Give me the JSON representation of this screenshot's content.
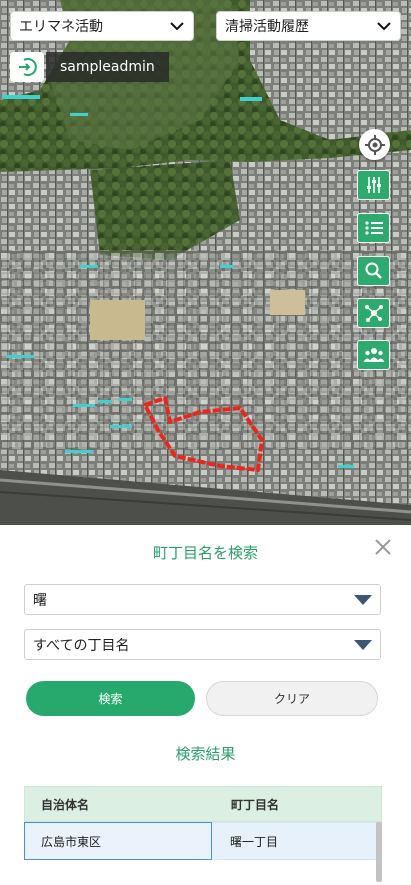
{
  "top": {
    "area_select": "エリマネ活動",
    "history_select": "清掃活動履歴"
  },
  "user": {
    "name": "sampleadmin"
  },
  "map_tools": [
    "locate-icon",
    "layer-adjust-icon",
    "list-icon",
    "search-icon",
    "network-icon",
    "group-icon"
  ],
  "panel": {
    "title": "町丁目名を検索",
    "area_value": "曙",
    "town_value": "すべての丁目名",
    "search_label": "検索",
    "clear_label": "クリア",
    "results_title": "検索結果",
    "columns": [
      "自治体名",
      "町丁目名"
    ],
    "rows": [
      {
        "municipality": "広島市東区",
        "town": "曙一丁目"
      }
    ]
  },
  "colors": {
    "accent": "#27a86c",
    "boundary": "#e8271e"
  }
}
